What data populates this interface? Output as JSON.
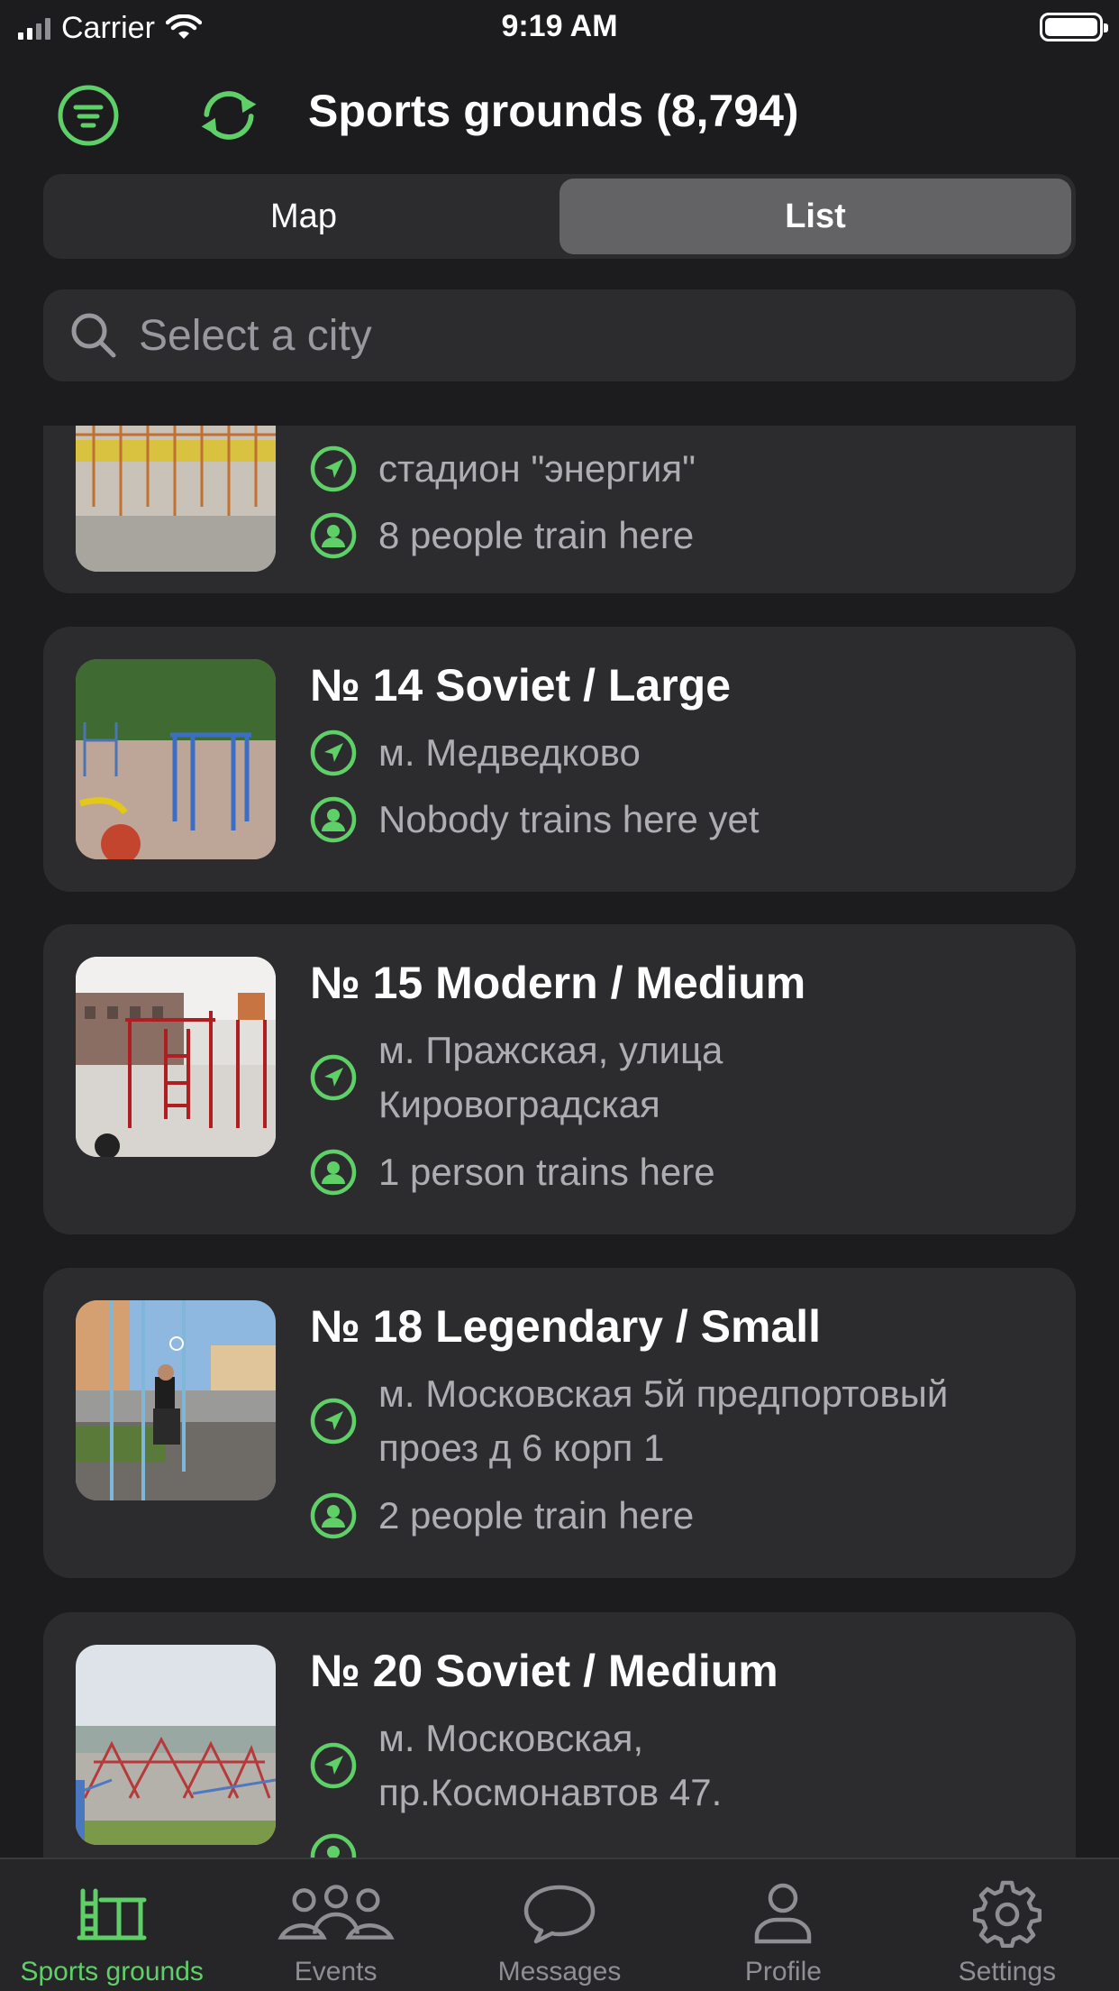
{
  "status_bar": {
    "carrier": "Carrier",
    "time": "9:19 AM"
  },
  "nav": {
    "title": "Sports grounds (8,794)",
    "filter_icon": "filter-icon",
    "refresh_icon": "refresh-icon"
  },
  "segmented": {
    "map_label": "Map",
    "list_label": "List",
    "selected": "List"
  },
  "search": {
    "placeholder": "Select a city"
  },
  "grounds": [
    {
      "title": "",
      "address": "стадион \"энергия\"",
      "people": "8 people train here"
    },
    {
      "title": "№ 14 Soviet / Large",
      "address": "м. Медведково",
      "people": "Nobody trains here yet"
    },
    {
      "title": "№ 15 Modern / Medium",
      "address_line1": "м. Пражская, улица",
      "address_line2": "Кировоградская",
      "people": "1 person trains here"
    },
    {
      "title": "№ 18 Legendary / Small",
      "address_line1": "м. Московская 5й предпортовый",
      "address_line2": "проез д 6 корп 1",
      "people": "2 people train here"
    },
    {
      "title": "№ 20 Soviet / Medium",
      "address_line1": "м. Московская,",
      "address_line2": "пр.Космонавтов 47."
    }
  ],
  "tab_bar": {
    "items": [
      {
        "label": "Sports grounds",
        "icon": "parallel-bars-icon",
        "active": true
      },
      {
        "label": "Events",
        "icon": "people-group-icon",
        "active": false
      },
      {
        "label": "Messages",
        "icon": "chat-bubble-icon",
        "active": false
      },
      {
        "label": "Profile",
        "icon": "person-icon",
        "active": false
      },
      {
        "label": "Settings",
        "icon": "gear-icon",
        "active": false
      }
    ]
  },
  "colors": {
    "accent": "#5fd068",
    "background": "#1c1c1e",
    "card": "#2c2c2e",
    "secondary_text": "#aeaeb2"
  }
}
